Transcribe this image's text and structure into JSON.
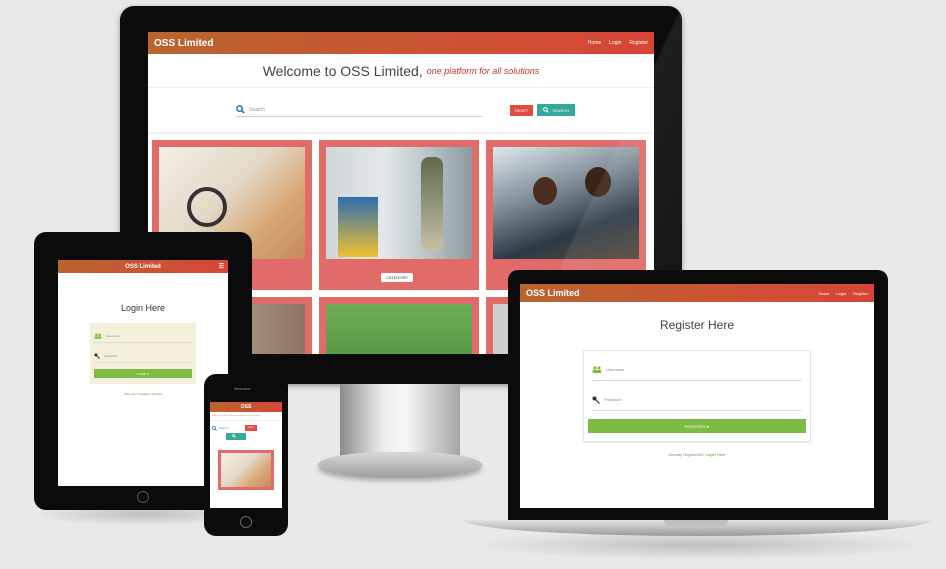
{
  "desktop": {
    "nav": {
      "brand": "OSS Limited",
      "links": [
        "Home",
        "Login",
        "Register"
      ]
    },
    "welcome": {
      "title": "Welcome to OSS Limited,",
      "tagline": "one platform for all solutions"
    },
    "search": {
      "placeholder": "Search",
      "reset_label": "RESET",
      "search_label": "SEARCH"
    },
    "category_button": "CATEGORY"
  },
  "laptop": {
    "nav": {
      "brand": "OSS Limited",
      "links": [
        "Home",
        "Login",
        "Register"
      ]
    },
    "title": "Register Here",
    "username_placeholder": "Username",
    "password_placeholder": "Password",
    "submit_label": "REGISTER",
    "footer_text": "Already Registered?",
    "footer_link": "Login Here"
  },
  "tablet": {
    "nav": {
      "brand": "OSS Limited"
    },
    "title": "Login Here",
    "username_placeholder": "Username",
    "password_placeholder": "Password",
    "submit_label": "LOGIN",
    "footer_link": "New User? Register Account"
  },
  "phone": {
    "speaker_label": "Welcome",
    "nav": {
      "brand": "OSS"
    },
    "subtitle": "Welcome to OSS Limited, one platform for all solutions",
    "search_placeholder": "Search",
    "reset_label": "RESET"
  },
  "colors": {
    "nav_start": "#b9652f",
    "nav_end": "#d84536",
    "accent_green": "#7dbb43",
    "accent_teal": "#33a89b",
    "accent_red": "#e24b41",
    "card_bg": "#e06b69"
  }
}
